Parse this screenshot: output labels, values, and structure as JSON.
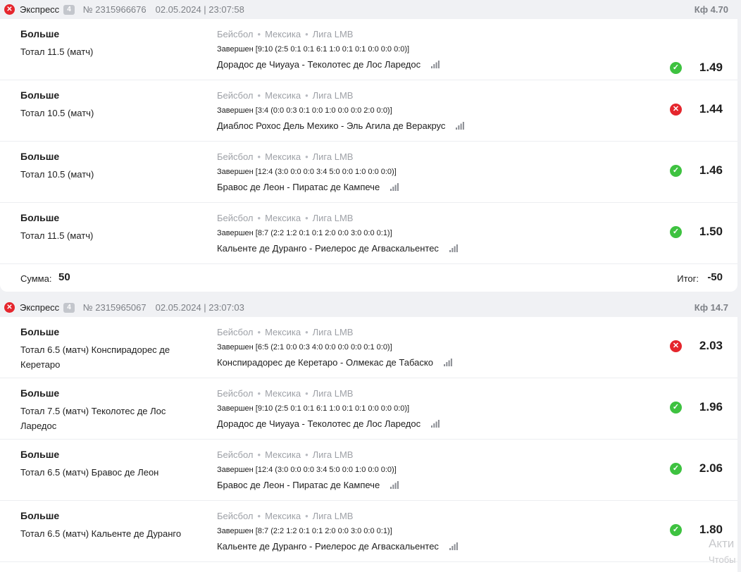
{
  "coupons": [
    {
      "type": "Экспресс",
      "count": "4",
      "number": "№ 2315966676",
      "datetime": "02.05.2024 | 23:07:58",
      "coef": "Кф 4.70",
      "status": "loss",
      "rows": [
        {
          "bet_type": "Больше",
          "bet_name": "Тотал 11.5 (матч)",
          "sport": "Бейсбол",
          "country": "Мексика",
          "league": "Лига LMB",
          "score": "Завершен [9:10 (2:5 0:1 0:1 6:1 1:0 0:1 0:1 0:0 0:0 0:0)]",
          "match": "Дорадос де Чиуауа - Теколотес де Лос Ларедос",
          "outcome": "win",
          "odd": "1.49"
        },
        {
          "bet_type": "Больше",
          "bet_name": "Тотал 10.5 (матч)",
          "sport": "Бейсбол",
          "country": "Мексика",
          "league": "Лига LMB",
          "score": "Завершен [3:4 (0:0 0:3 0:1 0:0 1:0 0:0 0:0 2:0 0:0)]",
          "match": "Диаблос Рохос Дель Мехико - Эль Агила де Веракрус",
          "outcome": "loss",
          "odd": "1.44"
        },
        {
          "bet_type": "Больше",
          "bet_name": "Тотал 10.5 (матч)",
          "sport": "Бейсбол",
          "country": "Мексика",
          "league": "Лига LMB",
          "score": "Завершен [12:4 (3:0 0:0 0:0 3:4 5:0 0:0 1:0 0:0 0:0)]",
          "match": "Бравос де Леон - Пиратас де Кампече",
          "outcome": "win",
          "odd": "1.46"
        },
        {
          "bet_type": "Больше",
          "bet_name": "Тотал 11.5 (матч)",
          "sport": "Бейсбол",
          "country": "Мексика",
          "league": "Лига LMB",
          "score": "Завершен [8:7 (2:2 1:2 0:1 0:1 2:0 0:0 3:0 0:0 0:1)]",
          "match": "Кальенте де Дуранго - Риелерос де Агваскальентес",
          "outcome": "win",
          "odd": "1.50"
        }
      ],
      "summary": {
        "sum_label": "Сумма:",
        "sum_value": "50",
        "total_label": "Итог:",
        "total_value": "-50"
      }
    },
    {
      "type": "Экспресс",
      "count": "4",
      "number": "№ 2315965067",
      "datetime": "02.05.2024 | 23:07:03",
      "coef": "Кф 14.7",
      "status": "loss",
      "rows": [
        {
          "bet_type": "Больше",
          "bet_name": "Тотал 6.5 (матч) Конспирадорес де Керетаро",
          "sport": "Бейсбол",
          "country": "Мексика",
          "league": "Лига LMB",
          "score": "Завершен [6:5 (2:1 0:0 0:3 4:0 0:0 0:0 0:0 0:1 0:0)]",
          "match": "Конспирадорес де Керетаро - Олмекас де Табаско",
          "outcome": "loss",
          "odd": "2.03"
        },
        {
          "bet_type": "Больше",
          "bet_name": "Тотал 7.5 (матч) Теколотес де Лос Ларедос",
          "sport": "Бейсбол",
          "country": "Мексика",
          "league": "Лига LMB",
          "score": "Завершен [9:10 (2:5 0:1 0:1 6:1 1:0 0:1 0:1 0:0 0:0 0:0)]",
          "match": "Дорадос де Чиуауа - Теколотес де Лос Ларедос",
          "outcome": "win",
          "odd": "1.96"
        },
        {
          "bet_type": "Больше",
          "bet_name": "Тотал 6.5 (матч) Бравос де Леон",
          "sport": "Бейсбол",
          "country": "Мексика",
          "league": "Лига LMB",
          "score": "Завершен [12:4 (3:0 0:0 0:0 3:4 5:0 0:0 1:0 0:0 0:0)]",
          "match": "Бравос де Леон - Пиратас де Кампече",
          "outcome": "win",
          "odd": "2.06"
        },
        {
          "bet_type": "Больше",
          "bet_name": "Тотал 6.5 (матч) Кальенте де Дуранго",
          "sport": "Бейсбол",
          "country": "Мексика",
          "league": "Лига LMB",
          "score": "Завершен [8:7 (2:2 1:2 0:1 0:1 2:0 0:0 3:0 0:0 0:1)]",
          "match": "Кальенте де Дуранго - Риелерос де Агваскальентес",
          "outcome": "win",
          "odd": "1.80"
        }
      ]
    }
  ],
  "watermark": {
    "line1": "Акти",
    "line2": "Чтобы"
  },
  "icons": {
    "win": "check-icon",
    "loss": "cross-icon",
    "stats": "stats-bars-icon"
  },
  "colors": {
    "win": "#3ec240",
    "loss": "#e5262d",
    "header_bg": "#f0f1f4",
    "muted_text": "#7d8086"
  }
}
